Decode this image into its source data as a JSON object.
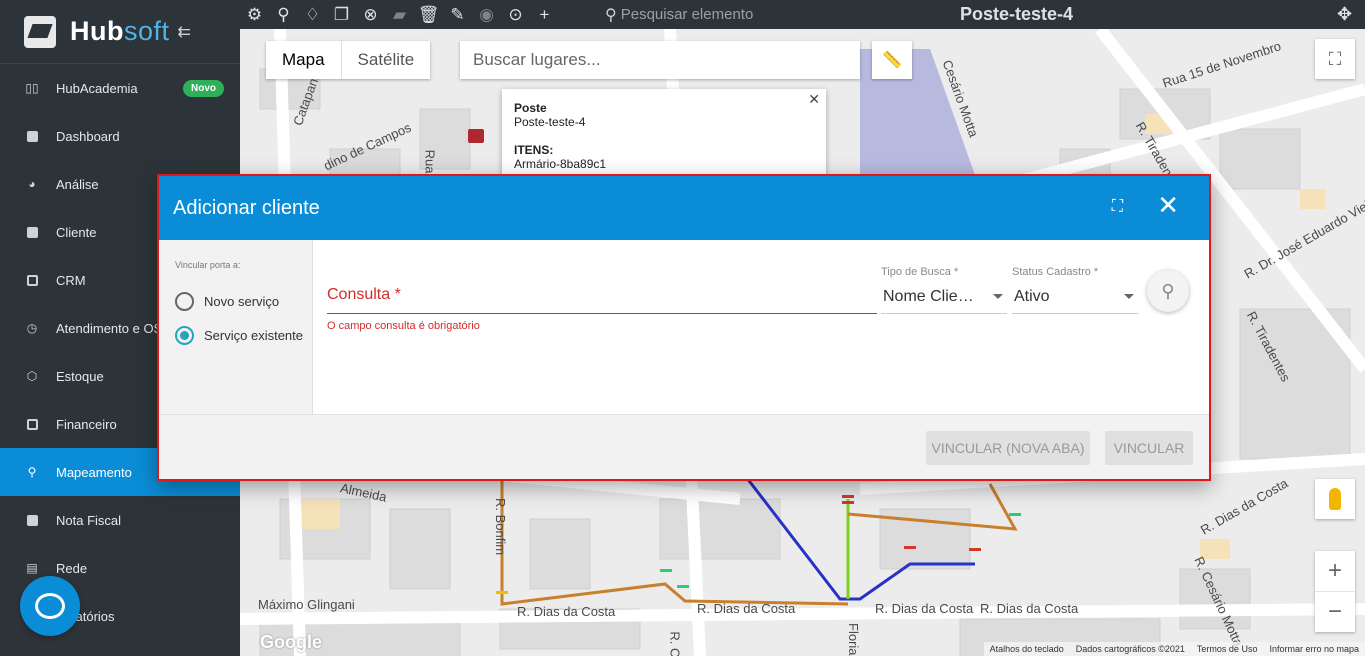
{
  "app": {
    "brand_main": "Hub",
    "brand_accent": "soft",
    "collapse_icon": "arrow-collapse-icon"
  },
  "sidebar": {
    "items": [
      {
        "label": "HubAcademia",
        "icon": "book-icon",
        "badge": "Novo"
      },
      {
        "label": "Dashboard",
        "icon": "dashboard-icon"
      },
      {
        "label": "Análise",
        "icon": "pie-chart-icon"
      },
      {
        "label": "Cliente",
        "icon": "client-card-icon"
      },
      {
        "label": "CRM",
        "icon": "crm-icon"
      },
      {
        "label": "Atendimento e OS",
        "icon": "calendar-clock-icon"
      },
      {
        "label": "Estoque",
        "icon": "box-icon"
      },
      {
        "label": "Financeiro",
        "icon": "money-icon"
      },
      {
        "label": "Mapeamento",
        "icon": "map-pin-icon",
        "active": true
      },
      {
        "label": "Nota Fiscal",
        "icon": "invoice-icon"
      },
      {
        "label": "Rede",
        "icon": "network-icon"
      },
      {
        "label": "Relatórios",
        "icon": "report-icon"
      }
    ]
  },
  "toolbar": {
    "search_placeholder": "Pesquisar elemento",
    "map_title": "Poste-teste-4",
    "icons": [
      "gear-icon",
      "map-marker-icon",
      "lightbulb-icon",
      "layers-icon",
      "close-circle-icon",
      "folder-icon",
      "trash-icon",
      "pencil-icon",
      "eye-icon",
      "location-icon",
      "plus-icon"
    ]
  },
  "map": {
    "type_map": "Mapa",
    "type_satellite": "Satélite",
    "place_placeholder": "Buscar lugares...",
    "info": {
      "type_label": "Poste",
      "name": "Poste-teste-4",
      "items_label": "ITENS:",
      "item": "Armário-8ba89c1"
    },
    "streets": [
      "Rua 15 de Novembro",
      "R. Tiradentes",
      "R. Dr. José Eduardo Vieira",
      "R. Dias da Costa",
      "R. Dias da Costa",
      "R. Dias da Costa",
      "R. Dias da Costa",
      "R. Dias da Costa",
      "Máximo Glingani",
      "R. Bonfim",
      "R. Cesário Motta",
      "Almeida",
      "Cesário Motta",
      "dino de Campos",
      "Catapani",
      "R. Tiradentes",
      "R. Cr",
      "Floriano",
      "Rua"
    ],
    "footer": [
      "Atalhos do teclado",
      "Dados cartográficos ©2021",
      "Termos de Uso",
      "Informar erro no mapa"
    ],
    "google": "Google"
  },
  "dialog": {
    "title": "Adicionar cliente",
    "link_label": "Vincular porta a:",
    "options": [
      "Novo serviço",
      "Serviço existente"
    ],
    "selected_option": "Serviço existente",
    "consulta_label": "Consulta *",
    "consulta_error": "O campo consulta é obrigatório",
    "tipo_busca_label": "Tipo de Busca *",
    "tipo_busca_value": "Nome Clie…",
    "status_label": "Status Cadastro *",
    "status_value": "Ativo",
    "btn_new_tab": "VINCULAR (NOVA ABA)",
    "btn_link": "VINCULAR"
  }
}
